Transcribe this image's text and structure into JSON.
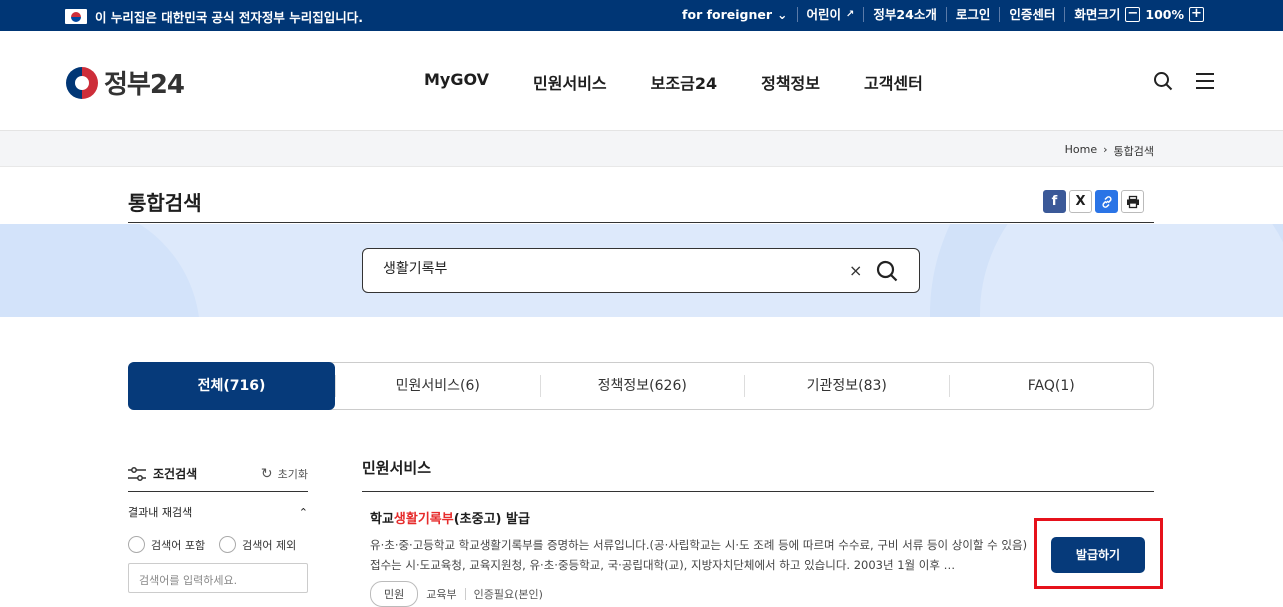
{
  "topbar": {
    "gov_notice": "이 누리집은 대한민국 공식 전자정부 누리집입니다.",
    "items": [
      "for foreigner",
      "어린이",
      "정부24소개",
      "로그인",
      "인증센터",
      "화면크기"
    ],
    "zoom": "100%",
    "zoom_minus": "−",
    "zoom_plus": "+"
  },
  "header": {
    "logo_text": "정부24",
    "nav": [
      "MyGOV",
      "민원서비스",
      "보조금24",
      "정책정보",
      "고객센터"
    ]
  },
  "breadcrumb": {
    "home": "Home",
    "current": "통합검색"
  },
  "page": {
    "title": "통합검색"
  },
  "share": {
    "facebook": "f",
    "x": "X"
  },
  "search": {
    "value": "생활기록부",
    "clear": "×"
  },
  "tabs": [
    "전체(716)",
    "민원서비스(6)",
    "정책정보(626)",
    "기관정보(83)",
    "FAQ(1)"
  ],
  "sidebar": {
    "title": "조건검색",
    "reset": "초기화",
    "refine_title": "결과내 재검색",
    "include": "검색어 포함",
    "exclude": "검색어 제외",
    "keyword_placeholder": "검색어를 입력하세요."
  },
  "main": {
    "section_title": "민원서비스",
    "result": {
      "title_pre": "학교",
      "title_hl": "생활기록부",
      "title_post": "(초중고) 발급",
      "desc": "유·초·중·고등학교 학교생활기록부를 증명하는 서류입니다.(공·사립학교는 시·도 조례 등에 따르며 수수료, 구비 서류 등이 상이할 수 있음) 접수는 시·도교육청, 교육지원청, 유·초·중등학교, 국·공립대학(교), 지방자치단체에서 하고 있습니다. 2003년 1월 이후 …",
      "tag": "민원",
      "agency": "교육부",
      "auth": "인증필요(본인)",
      "button": "발급하기"
    }
  },
  "colors": {
    "brand": "#003675",
    "active_tab": "#063a7a",
    "highlight": "#e62b2b"
  }
}
